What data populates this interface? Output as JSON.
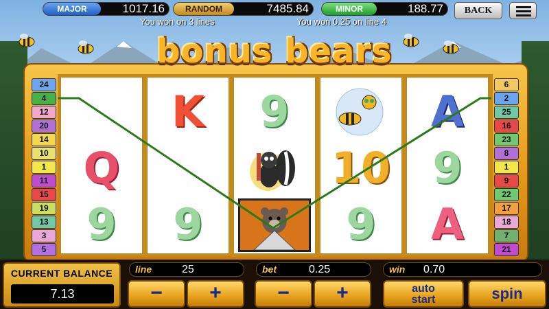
{
  "jackpots": [
    {
      "label": "MAJOR",
      "value": "1017.16"
    },
    {
      "label": "RANDOM",
      "value": "7485.84"
    },
    {
      "label": "MINOR",
      "value": "188.77"
    }
  ],
  "nav": {
    "back_label": "BACK",
    "menu_icon": "hamburger-menu-icon"
  },
  "messages": [
    "You won on 3 lines",
    "You won 0.25 on line 4"
  ],
  "logo": {
    "text": "bonus bears"
  },
  "line_numbers_left": [
    "24",
    "4",
    "12",
    "20",
    "14",
    "10",
    "1",
    "11",
    "15",
    "19",
    "13",
    "3",
    "5"
  ],
  "line_numbers_right": [
    "6",
    "2",
    "25",
    "16",
    "23",
    "8",
    "1",
    "9",
    "22",
    "17",
    "18",
    "7",
    "21"
  ],
  "tab_colors": [
    "#6aa6f0",
    "#48b048",
    "#f2a8c8",
    "#b070d8",
    "#f2d84a",
    "#e8e070",
    "#f2e84a",
    "#c04ad0",
    "#e84848",
    "#c8e060",
    "#70c8a8",
    "#e8a8d8",
    "#b070e0"
  ],
  "tab_colors_right": [
    "#f2c860",
    "#6aa6f0",
    "#70c8a8",
    "#e84848",
    "#70c870",
    "#b070d8",
    "#f2e84a",
    "#e84848",
    "#70c870",
    "#f2a040",
    "#e8a8d8",
    "#70b070",
    "#c04ad0"
  ],
  "reels": [
    {
      "symbols": [
        "",
        "Q",
        "9"
      ]
    },
    {
      "symbols": [
        "K",
        "",
        "9"
      ]
    },
    {
      "symbols": [
        "9",
        "skunk",
        "bear"
      ]
    },
    {
      "symbols": [
        "bee",
        "10",
        "9"
      ]
    },
    {
      "symbols": [
        "A",
        "9",
        "A"
      ]
    }
  ],
  "controls": {
    "balance_label": "CURRENT BALANCE",
    "balance_value": "7.13",
    "line_label": "line",
    "line_value": "25",
    "bet_label": "bet",
    "bet_value": "0.25",
    "win_label": "win",
    "win_value": "0.70",
    "minus_label": "−",
    "plus_label": "+",
    "auto_label_1": "auto",
    "auto_label_2": "start",
    "spin_label": "spin"
  }
}
